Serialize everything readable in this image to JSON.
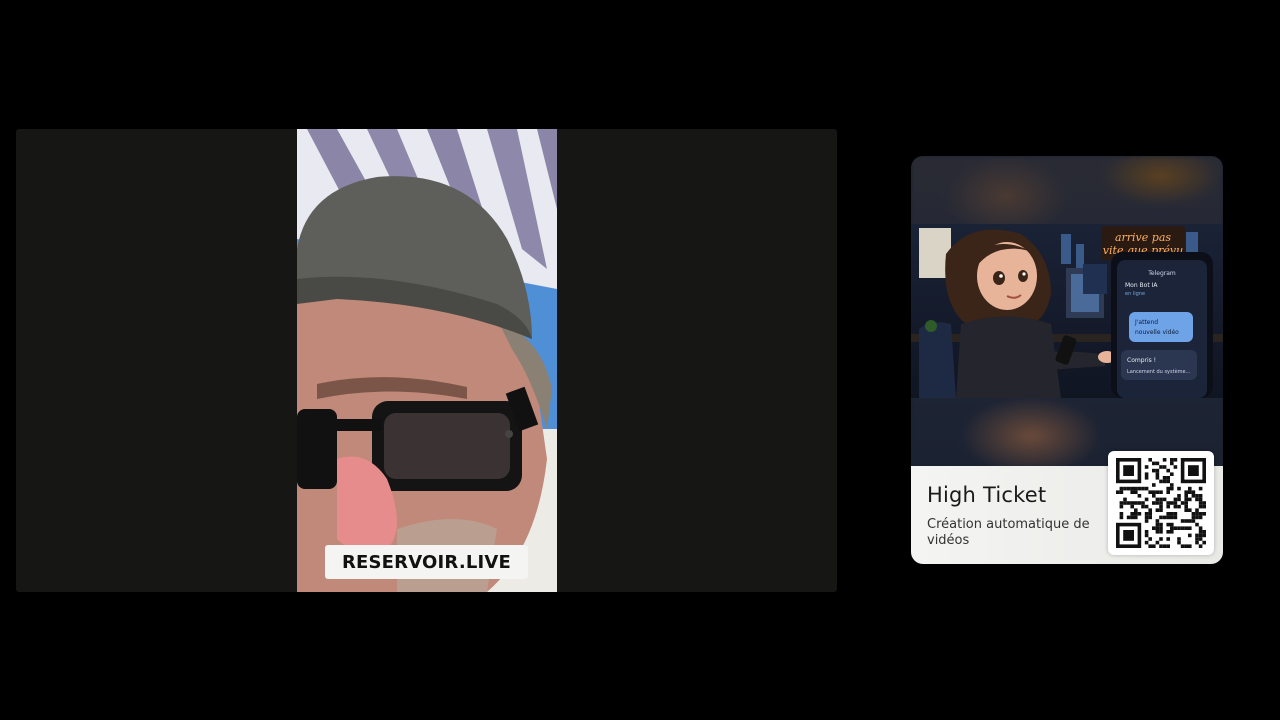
{
  "video": {
    "caption": "RESERVOIR.LIVE"
  },
  "promo_card": {
    "title": "High Ticket",
    "subtitle": "Création automatique de vidéos",
    "art": {
      "neon_sign": "arrive pas vite que prévu",
      "phone_app": "Telegram",
      "chat_name": "Mon Bot IA",
      "chat_status": "en ligne",
      "message_sent": "J'attend nouvelle vidéo",
      "message_received": "Compris !",
      "message_received_detail": "Lancement du système..."
    }
  },
  "colors": {
    "background": "#000000",
    "stage": "#161614",
    "caption_bg": "#f4f4f2"
  }
}
